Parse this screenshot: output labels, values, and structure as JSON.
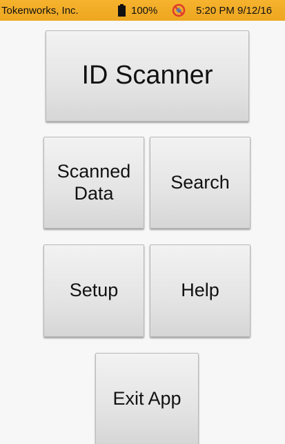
{
  "status_bar": {
    "company": "Tokenworks, Inc.",
    "battery_icon": "battery-icon",
    "battery_level": "100%",
    "no_sign_icon": "no-sign-icon",
    "datetime": "5:20 PM 9/12/16",
    "background_color": "#f0aa22"
  },
  "menu": {
    "id_scanner": "ID Scanner",
    "scanned_data": "Scanned Data",
    "search": "Search",
    "setup": "Setup",
    "help": "Help",
    "exit_app": "Exit App"
  }
}
